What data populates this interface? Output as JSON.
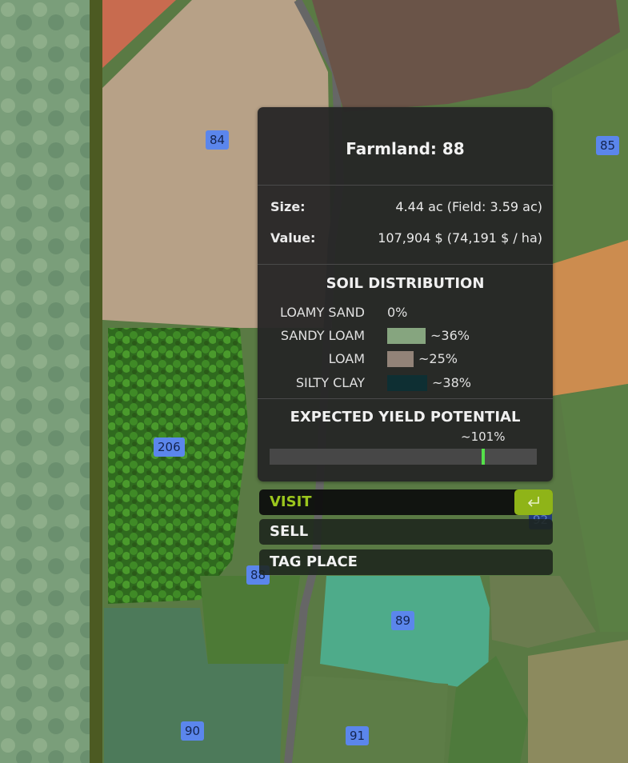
{
  "colors": {
    "field_light_brown": "#b7a187",
    "field_dark_brown": "#6a5448",
    "field_orange": "#cc8c4f",
    "field_teal": "#4eab8a",
    "field_green": "#5d7f43",
    "marker_blue": "#5b86ec",
    "accent_green": "#9bc61d",
    "yield_marker": "#55e04a"
  },
  "map": {
    "markers": [
      {
        "id": "84",
        "label": "84"
      },
      {
        "id": "85",
        "label": "85"
      },
      {
        "id": "206",
        "label": "206"
      },
      {
        "id": "88",
        "label": "88"
      },
      {
        "id": "89",
        "label": "89"
      },
      {
        "id": "90",
        "label": "90"
      },
      {
        "id": "91",
        "label": "91"
      },
      {
        "id": "92",
        "label": "92"
      }
    ]
  },
  "panel": {
    "title": "Farmland: 88",
    "size_label": "Size:",
    "size_value": "4.44 ac (Field: 3.59 ac)",
    "value_label": "Value:",
    "value_value": "107,904 $ (74,191 $ / ha)",
    "soil_title": "SOIL DISTRIBUTION",
    "soil": [
      {
        "name": "LOAMY SAND",
        "pct": "0%",
        "share": 0,
        "color": "#000000"
      },
      {
        "name": "SANDY LOAM",
        "pct": "~36%",
        "share": 36,
        "color": "#86a57f"
      },
      {
        "name": "LOAM",
        "pct": "~25%",
        "share": 25,
        "color": "#928378"
      },
      {
        "name": "SILTY CLAY",
        "pct": "~38%",
        "share": 38,
        "color": "#0e2f33"
      }
    ],
    "yield_title": "EXPECTED YIELD POTENTIAL",
    "yield_pct": "~101%",
    "yield_fraction": 0.8
  },
  "actions": {
    "visit": "VISIT",
    "sell": "SELL",
    "tag_place": "TAG PLACE",
    "visit_icon": "enter-icon"
  }
}
